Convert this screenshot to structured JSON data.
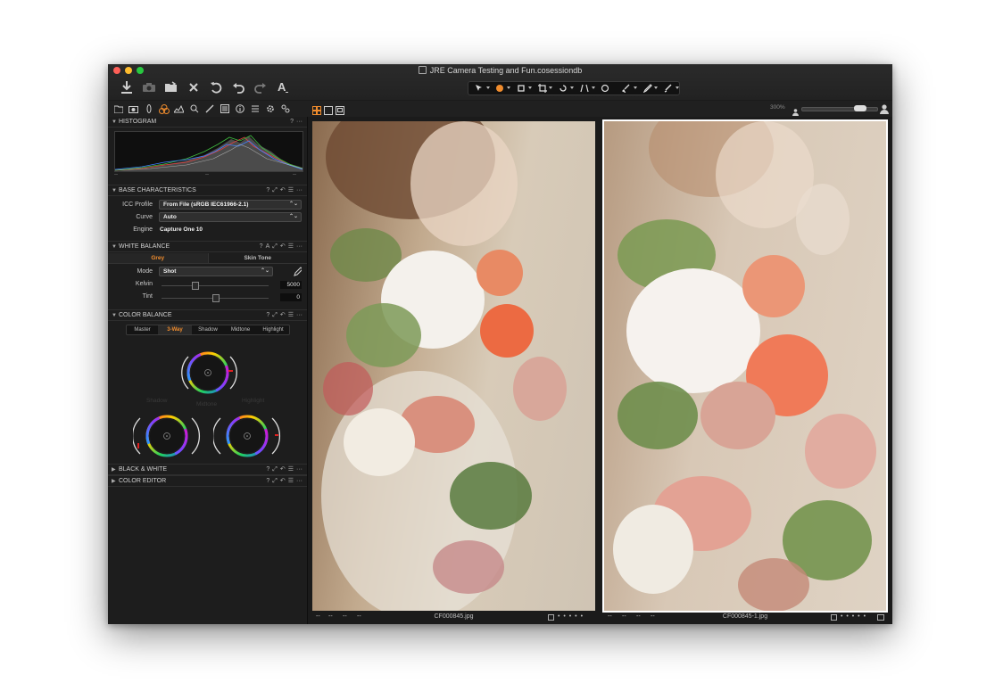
{
  "window": {
    "title": "JRE Camera Testing and Fun.cosessiondb"
  },
  "toolbar": {
    "left_tools": [
      "import-icon",
      "camera-icon",
      "folder-move-icon",
      "delete-icon",
      "reset-icon",
      "undo-icon",
      "redo-icon",
      "text-icon"
    ],
    "zoom": "300%"
  },
  "panels": {
    "histogram": {
      "title": "HISTOGRAM",
      "footer": [
        "--",
        "--",
        "--"
      ]
    },
    "base": {
      "title": "BASE CHARACTERISTICS",
      "icc_label": "ICC Profile",
      "icc_value": "From File (sRGB IEC61966-2.1)",
      "curve_label": "Curve",
      "curve_value": "Auto",
      "engine_label": "Engine",
      "engine_value": "Capture One 10"
    },
    "white_balance": {
      "title": "WHITE BALANCE",
      "tabs": [
        "Grey",
        "Skin Tone"
      ],
      "mode_label": "Mode",
      "mode_value": "Shot",
      "kelvin_label": "Kelvin",
      "kelvin_value": "5000",
      "tint_label": "Tint",
      "tint_value": "0"
    },
    "color_balance": {
      "title": "COLOR BALANCE",
      "tabs": [
        "Master",
        "3-Way",
        "Shadow",
        "Midtone",
        "Highlight"
      ],
      "wheel_labels": {
        "shadow": "Shadow",
        "midtone": "Midtone",
        "highlight": "Highlight"
      }
    },
    "bw": {
      "title": "BLACK & WHITE"
    },
    "color_editor": {
      "title": "COLOR EDITOR"
    },
    "header_icons": {
      "help": "?",
      "a": "A",
      "menu": "☰",
      "more": "···"
    }
  },
  "viewer": {
    "left_caption": "CF000845.jpg",
    "right_caption": "CF000845-1.jpg",
    "dashes": [
      "--",
      "--",
      "--",
      "--"
    ]
  },
  "colors": {
    "accent": "#f08c2d",
    "panel_bg": "#1d1d1d",
    "text": "#cfcfcf",
    "close": "#fe5f57",
    "minimize": "#febc2e",
    "zoom": "#28c840"
  }
}
